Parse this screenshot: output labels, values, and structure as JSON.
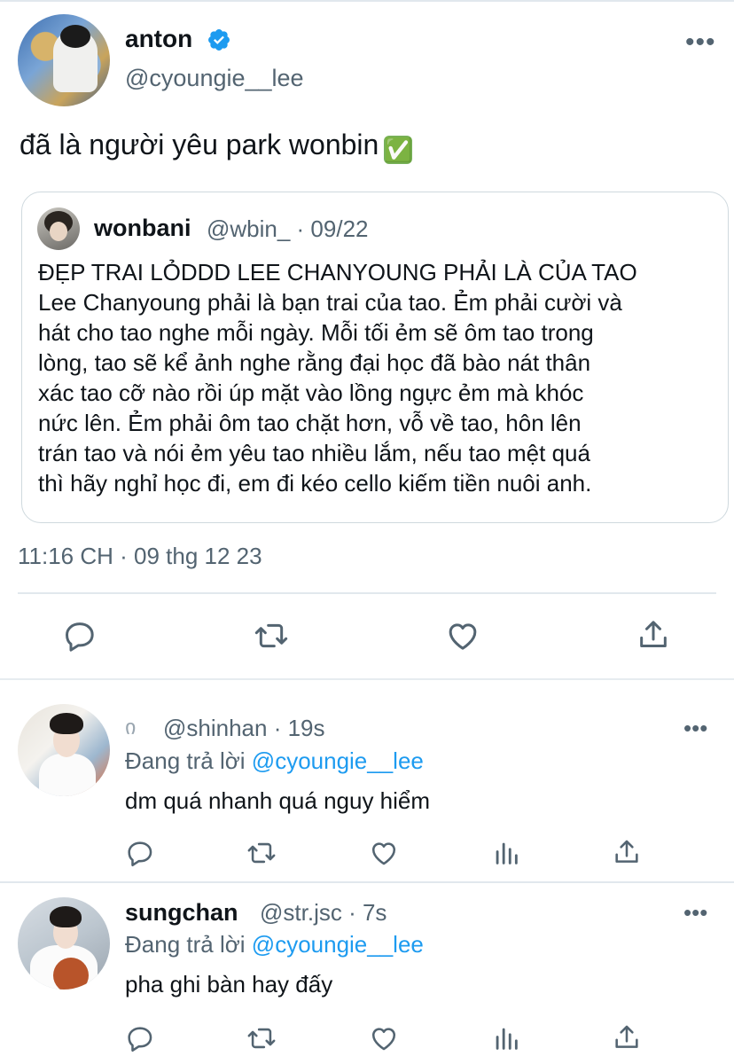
{
  "tweet": {
    "author_name": "anton",
    "author_handle": "@cyoungie__lee",
    "text": "đã là người yêu park wonbin",
    "emoji": "✅",
    "timestamp": "11:16 CH · 09 thg 12 23"
  },
  "quote": {
    "author_name": "wonbani",
    "meta": "@wbin_ · 09/22",
    "body": "ĐẸP TRAI LỎDDD LEE CHANYOUNG PHẢI LÀ CỦA TAO\nLee Chanyoung phải là bạn trai của tao. Ẻm phải cười và\nhát cho tao nghe mỗi ngày. Mỗi tối ẻm sẽ ôm tao trong\nlòng, tao sẽ kể ảnh nghe rằng đại học đã bào nát thân\nxác tao cỡ nào rồi úp mặt vào lồng ngực ẻm mà khóc\nnức lên. Ẻm phải ôm tao chặt hơn, vỗ về tao, hôn lên\ntrán tao và nói ẻm yêu tao nhiều lắm, nếu tao mệt quá\nthì hãy nghỉ học đi, em đi kéo cello kiếm tiền nuôi anh."
  },
  "replies": [
    {
      "name": "",
      "handle_time": "@shinhan · 19s",
      "replying_prefix": "Đang trả lời",
      "replying_to": "@cyoungie__lee",
      "text": "dm quá nhanh quá nguy hiểm"
    },
    {
      "name": "sungchan",
      "handle_time": "@str.jsc · 7s",
      "replying_prefix": "Đang trả lời",
      "replying_to": "@cyoungie__lee",
      "text": "pha ghi bàn hay đấy"
    }
  ],
  "more_glyph": "•••",
  "icons": [
    "verified-icon",
    "more-icon",
    "reply-icon",
    "retweet-icon",
    "like-icon",
    "share-icon",
    "analytics-icon"
  ],
  "colors": {
    "accent": "#1d9bf0",
    "text": "#0f1419",
    "secondary": "#536471",
    "border": "#cfd9de"
  }
}
